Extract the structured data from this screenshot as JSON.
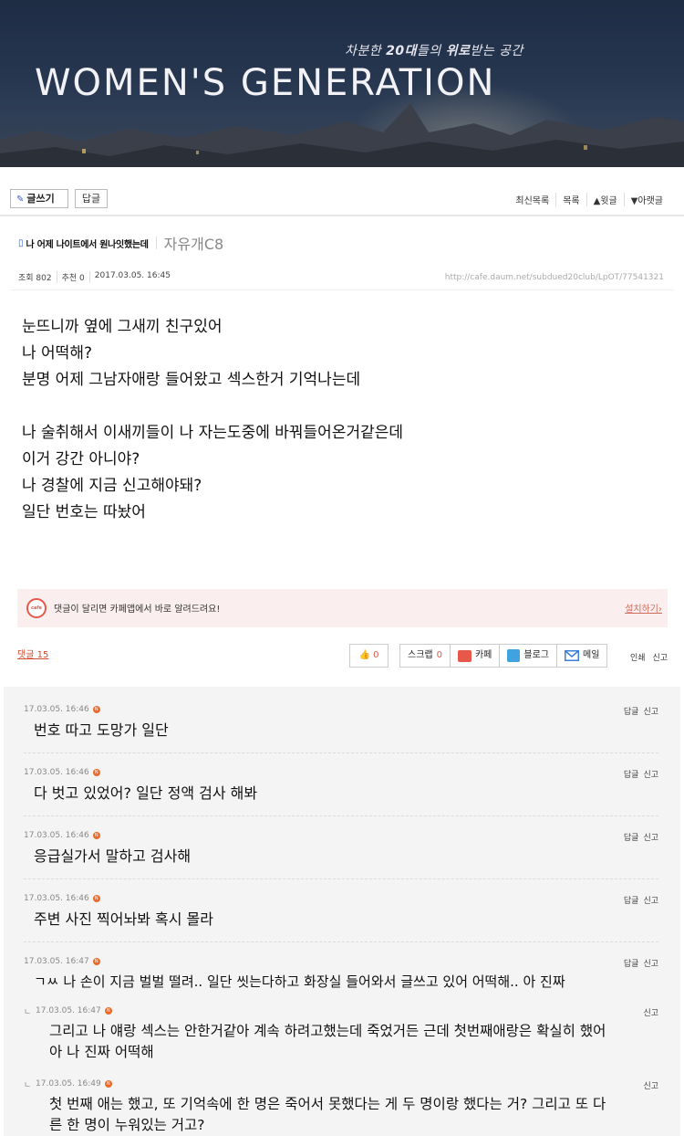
{
  "banner": {
    "tagline_prefix": "차분한 ",
    "tagline_bold1": "20대",
    "tagline_mid": "들의 ",
    "tagline_bold2": "위로",
    "tagline_suffix": "받는 공간",
    "title": "WOMEN'S GENERATION"
  },
  "toolbar": {
    "write_label": "글쓰기",
    "reply_label": "답글",
    "nav": [
      "최신목록",
      "목록",
      "▲윗글",
      "▼아랫글"
    ]
  },
  "post": {
    "title": "나 어제 나이트에서 원나잇했는데",
    "board": "자유개C8",
    "views": "조회 802",
    "recommend": "추천 0",
    "datetime": "2017.03.05. 16:45",
    "url": "http://cafe.daum.net/subdued20club/LpOT/77541321",
    "body_lines": [
      "눈뜨니까 옆에 그새끼 친구있어",
      "나 어떡해?",
      "분명 어제 그남자애랑 들어왔고 섹스한거 기억나는데",
      "",
      "나 술취해서 이새끼들이 나 자는도중에 바꿔들어온거같은데",
      "이거 강간 아니야?",
      "나 경찰에 지금 신고해야돼?",
      "일단 번호는 따놨어"
    ]
  },
  "notice": {
    "icon": "cafe",
    "message": "댓글이 달리면 카페앱에서 바로 알려드려요!",
    "install": "설치하기"
  },
  "actions": {
    "comment_count": "댓글 15",
    "like_count": "0",
    "scrap_label": "스크랩",
    "scrap_count": "0",
    "cafe_label": "카페",
    "blog_label": "블로그",
    "mail_label": "메일",
    "print_label": "인쇄",
    "report_label": "신고"
  },
  "comments": [
    {
      "time": "17.03.05. 16:46",
      "text": "번호 따고 도망가 일단",
      "reply": "답글",
      "report": "신고"
    },
    {
      "time": "17.03.05. 16:46",
      "text": "다 벗고 있었어? 일단 정액 검사 해봐",
      "reply": "답글",
      "report": "신고"
    },
    {
      "time": "17.03.05. 16:46",
      "text": "응급실가서 말하고 검사해",
      "reply": "답글",
      "report": "신고"
    },
    {
      "time": "17.03.05. 16:46",
      "text": "주변 사진 찍어놔봐 혹시 몰라",
      "reply": "답글",
      "report": "신고"
    },
    {
      "time": "17.03.05. 16:47",
      "text": "ㄱㅆ 나 손이 지금 벌벌 떨려.. 일단 씻는다하고 화장실 들어와서 글쓰고 있어 어떡해.. 아 진짜",
      "reply": "답글",
      "report": "신고"
    }
  ],
  "replies": [
    {
      "mark": "ㄴ",
      "time": "17.03.05. 16:47",
      "line1": "그리고 나 얘랑 섹스는 안한거같아 계속 하려고했는데 죽었거든 근데 첫번째애랑은 확실히 했어",
      "line2": "아 나 진짜 어떡해",
      "report": "신고"
    },
    {
      "mark": "ㄴ",
      "time": "17.03.05. 16:49",
      "line1": "첫 번째 애는 했고, 또 기억속에 한 명은 죽어서 못했다는 게 두 명이랑 했다는 거? 그리고 또 다",
      "line2": "른 한 명이 누워있는 거고?",
      "report": "신고"
    }
  ],
  "new_badge": "N"
}
